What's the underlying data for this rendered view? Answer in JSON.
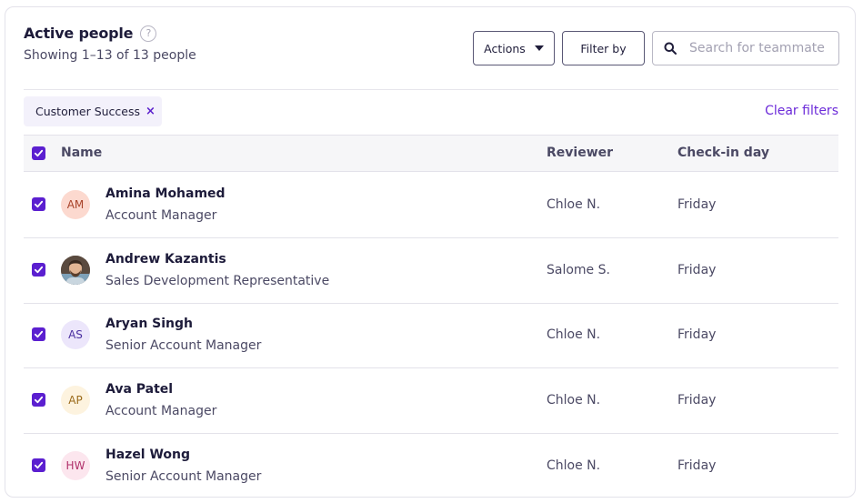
{
  "header": {
    "title": "Active people",
    "help_icon": "?",
    "subtitle": "Showing 1–13 of 13 people"
  },
  "toolbar": {
    "actions_label": "Actions",
    "filter_label": "Filter by",
    "search_placeholder": "Search for teammate"
  },
  "filters": {
    "chip_label": "Customer Success",
    "chip_remove": "×",
    "clear_label": "Clear filters"
  },
  "table": {
    "columns": {
      "name": "Name",
      "reviewer": "Reviewer",
      "checkin": "Check-in day"
    },
    "rows": [
      {
        "initials": "AM",
        "name": "Amina Mohamed",
        "role": "Account Manager",
        "reviewer": "Chloe N.",
        "checkin": "Friday",
        "avatar_bg": "#fcd9cf",
        "avatar_fg": "#a8432a"
      },
      {
        "initials": "",
        "name": "Andrew Kazantis",
        "role": "Sales Development Representative",
        "reviewer": "Salome S.",
        "checkin": "Friday",
        "avatar_bg": "#6b5a4e",
        "avatar_fg": "#ffffff"
      },
      {
        "initials": "AS",
        "name": "Aryan Singh",
        "role": "Senior Account Manager",
        "reviewer": "Chloe N.",
        "checkin": "Friday",
        "avatar_bg": "#ece6fb",
        "avatar_fg": "#4a2fa0"
      },
      {
        "initials": "AP",
        "name": "Ava Patel",
        "role": "Account Manager",
        "reviewer": "Chloe N.",
        "checkin": "Friday",
        "avatar_bg": "#fdf3df",
        "avatar_fg": "#9a6a1a"
      },
      {
        "initials": "HW",
        "name": "Hazel Wong",
        "role": "Senior Account Manager",
        "reviewer": "Chloe N.",
        "checkin": "Friday",
        "avatar_bg": "#fce6ee",
        "avatar_fg": "#b0306a"
      }
    ]
  },
  "colors": {
    "accent": "#5b1fd0",
    "link": "#6c2bd9"
  }
}
